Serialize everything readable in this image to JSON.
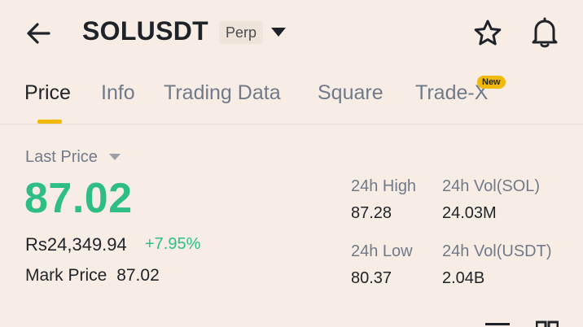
{
  "header": {
    "symbol": "SOLUSDT",
    "badge": "Perp",
    "icons": {
      "back": "arrow-left-icon",
      "dropdown": "caret-down-icon",
      "favorite": "star-icon",
      "alerts": "bell-icon"
    }
  },
  "tabs": [
    {
      "label": "Price",
      "active": true
    },
    {
      "label": "Info",
      "active": false
    },
    {
      "label": "Trading Data",
      "active": false
    },
    {
      "label": "Square",
      "active": false
    },
    {
      "label": "Trade-X",
      "active": false,
      "badge": "New"
    }
  ],
  "ticker": {
    "last_price_label": "Last Price",
    "last_price": "87.02",
    "fiat_value": "Rs24,349.94",
    "change_pct": "+7.95%",
    "mark_price_label": "Mark Price",
    "mark_price": "87.02"
  },
  "stats": {
    "high_label": "24h High",
    "high": "87.28",
    "vol_base_label": "24h Vol(SOL)",
    "vol_base": "24.03M",
    "low_label": "24h Low",
    "low": "80.37",
    "vol_quote_label": "24h Vol(USDT)",
    "vol_quote": "2.04B"
  },
  "colors": {
    "background": "#f7ede5",
    "up": "#2ebd85",
    "accent": "#f0b90b",
    "text_primary": "#1e2329",
    "text_secondary": "#707a8a"
  }
}
